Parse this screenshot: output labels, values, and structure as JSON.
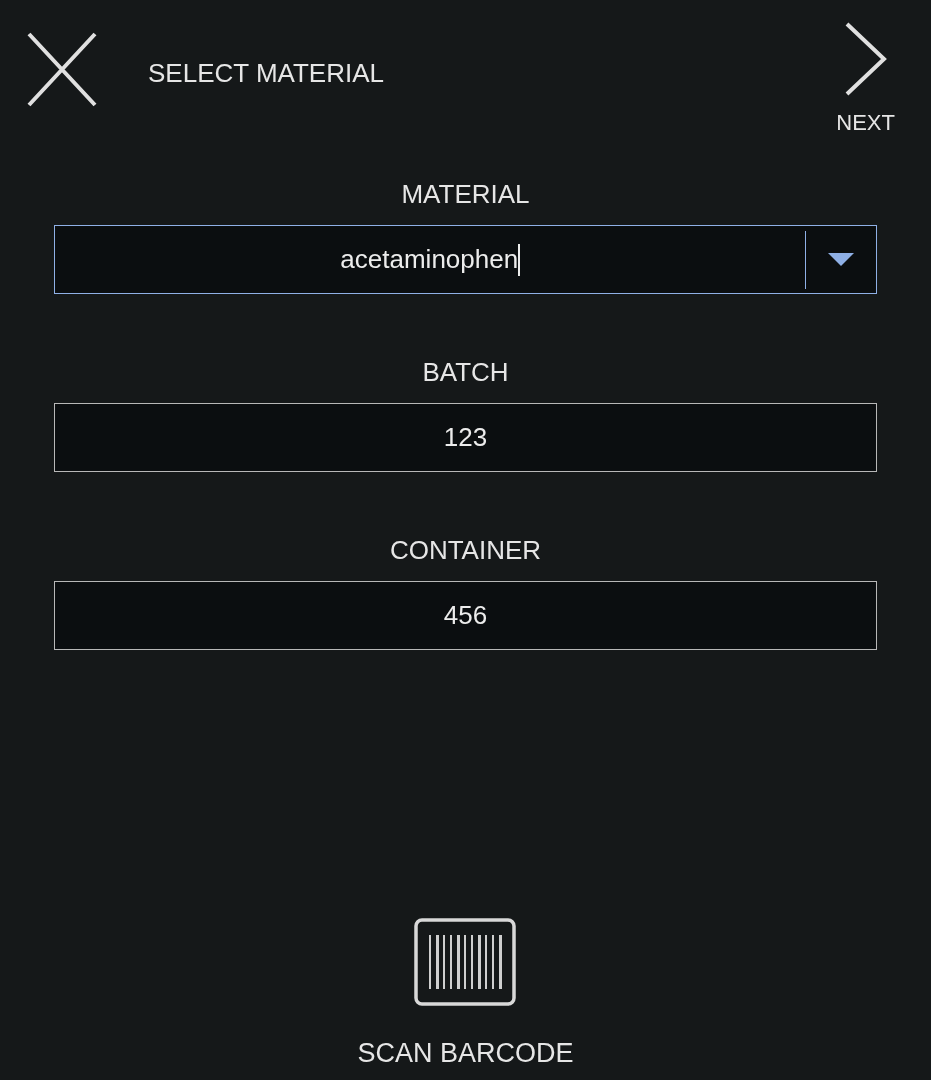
{
  "header": {
    "title": "SELECT MATERIAL",
    "next_label": "NEXT"
  },
  "fields": [
    {
      "label": "MATERIAL",
      "value": "acetaminophen",
      "kind": "dropdown",
      "focused": true
    },
    {
      "label": "BATCH",
      "value": "123",
      "kind": "text",
      "focused": false
    },
    {
      "label": "CONTAINER",
      "value": "456",
      "kind": "text",
      "focused": false
    }
  ],
  "scan_button": {
    "label": "SCAN BARCODE"
  }
}
